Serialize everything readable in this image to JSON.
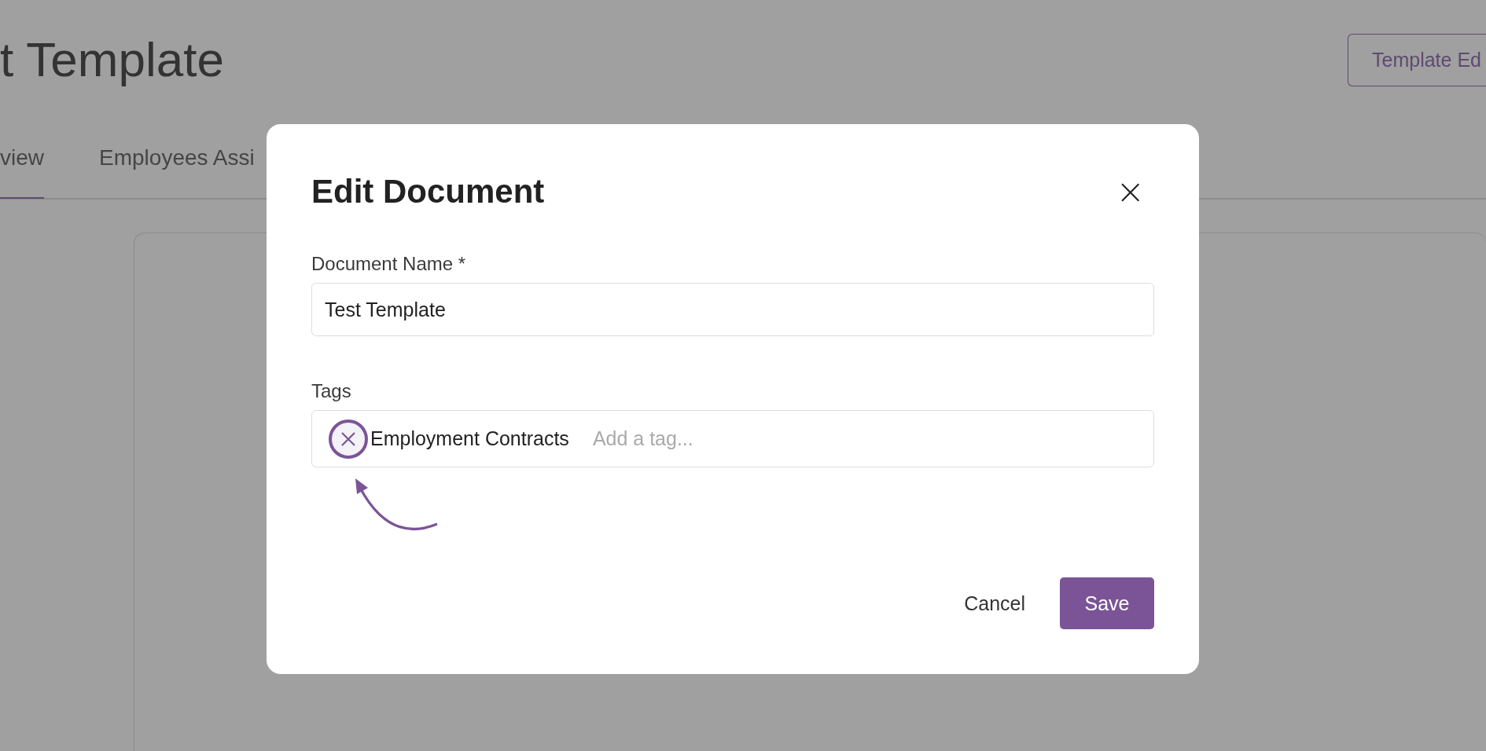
{
  "page": {
    "title": "t Template",
    "header_button": "Template Ed"
  },
  "tabs": [
    {
      "label": "view",
      "selected": true
    },
    {
      "label": "Employees Assi",
      "selected": false
    }
  ],
  "modal": {
    "title": "Edit Document",
    "close": "×",
    "name_field": {
      "label": "Document Name *",
      "value": "Test Template"
    },
    "tags_field": {
      "label": "Tags",
      "tags": [
        {
          "label": "Employment Contracts"
        }
      ],
      "placeholder": "Add a tag..."
    },
    "buttons": {
      "cancel": "Cancel",
      "save": "Save"
    }
  }
}
